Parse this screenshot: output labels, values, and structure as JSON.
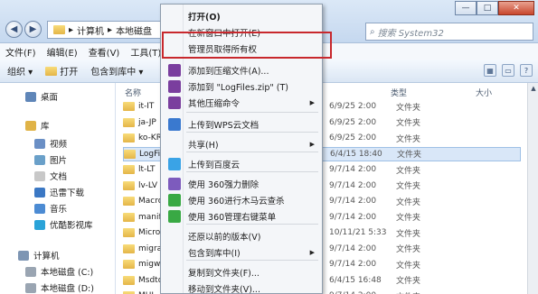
{
  "window": {
    "minimize": "—",
    "maximize": "□",
    "close": "✕"
  },
  "nav": {
    "back": "◀",
    "forward": "▶"
  },
  "address": {
    "crumbs": [
      "▸",
      "计算机",
      "▸",
      "本地磁盘"
    ]
  },
  "search": {
    "placeholder": "搜索 System32"
  },
  "menubar": [
    "文件(F)",
    "编辑(E)",
    "查看(V)",
    "工具(T)"
  ],
  "toolbar": {
    "organize": "组织 ▾",
    "open": "打开",
    "include": "包含到库中 ▾"
  },
  "sidebar": {
    "items": [
      {
        "label": "桌面",
        "icon": "desktop-icon",
        "color": "#5f86b8"
      },
      {
        "label": "库",
        "icon": "library-icon",
        "color": "#e0b347"
      },
      {
        "label": "视频",
        "icon": "video-icon",
        "color": "#6a8fc5"
      },
      {
        "label": "图片",
        "icon": "picture-icon",
        "color": "#6aa0c9"
      },
      {
        "label": "文档",
        "icon": "document-icon",
        "color": "#c8c8c8"
      },
      {
        "label": "迅雷下载",
        "icon": "thunder-icon",
        "color": "#3b78c4"
      },
      {
        "label": "音乐",
        "icon": "music-icon",
        "color": "#4c8bd3"
      },
      {
        "label": "优酷影视库",
        "icon": "youku-icon",
        "color": "#2aa3d8"
      },
      {
        "label": "计算机",
        "icon": "computer-icon",
        "color": "#7d95b3"
      },
      {
        "label": "本地磁盘 (C:)",
        "icon": "drive-icon",
        "color": "#9aa5b2"
      },
      {
        "label": "本地磁盘 (D:)",
        "icon": "drive-icon",
        "color": "#9aa5b2"
      }
    ]
  },
  "list": {
    "columns": {
      "name": "名称",
      "type": "类型",
      "size": "大小"
    },
    "rows": [
      {
        "name": "it-IT",
        "date": "6/9/25 2:00",
        "type": "文件夹"
      },
      {
        "name": "ja-JP",
        "date": "6/9/25 2:00",
        "type": "文件夹"
      },
      {
        "name": "ko-KR",
        "date": "6/9/25 2:00",
        "type": "文件夹"
      },
      {
        "name": "LogFil",
        "date": "6/4/15 18:40",
        "type": "文件夹"
      },
      {
        "name": "lt-LT",
        "date": "9/7/14 2:00",
        "type": "文件夹"
      },
      {
        "name": "lv-LV",
        "date": "9/7/14 2:00",
        "type": "文件夹"
      },
      {
        "name": "Macro",
        "date": "9/7/14 2:00",
        "type": "文件夹"
      },
      {
        "name": "manif",
        "date": "9/7/14 2:00",
        "type": "文件夹"
      },
      {
        "name": "Micro",
        "date": "10/11/21 5:33",
        "type": "文件夹"
      },
      {
        "name": "migra",
        "date": "9/7/14 2:00",
        "type": "文件夹"
      },
      {
        "name": "migwi",
        "date": "9/7/14 2:00",
        "type": "文件夹"
      },
      {
        "name": "Msdto",
        "date": "6/4/15 16:48",
        "type": "文件夹"
      },
      {
        "name": "MUI",
        "date": "9/7/14 2:00",
        "type": "文件夹"
      }
    ]
  },
  "context_menu": {
    "items": [
      {
        "label": "打开(O)",
        "bold": true,
        "icon": ""
      },
      {
        "label": "在新窗口中打开(E)",
        "icon": ""
      },
      {
        "label": "管理员取得所有权",
        "icon": ""
      },
      {
        "label": "添加到压缩文件(A)...",
        "icon": "winrar-icon",
        "color": "#7a3e9e"
      },
      {
        "label": "添加到 \"LogFiles.zip\" (T)",
        "icon": "winrar-icon",
        "color": "#7a3e9e"
      },
      {
        "label": "其他压缩命令",
        "icon": "winrar-icon",
        "color": "#7a3e9e",
        "submenu": true
      },
      {
        "label": "上传到WPS云文档",
        "icon": "wps-cloud-icon",
        "color": "#3a79cf"
      },
      {
        "label": "共享(H)",
        "icon": "",
        "submenu": true
      },
      {
        "label": "上传到百度云",
        "icon": "baidu-cloud-icon",
        "color": "#3aa3e6"
      },
      {
        "label": "使用 360强力删除",
        "icon": "360-icon",
        "color": "#7d5bbd"
      },
      {
        "label": "使用 360进行木马云查杀",
        "icon": "360-icon",
        "color": "#39a944"
      },
      {
        "label": "使用 360管理右键菜单",
        "icon": "360-icon",
        "color": "#39a944"
      },
      {
        "label": "还原以前的版本(V)",
        "icon": ""
      },
      {
        "label": "包含到库中(I)",
        "icon": "",
        "submenu": true
      },
      {
        "label": "复制到文件夹(F)...",
        "icon": ""
      },
      {
        "label": "移动到文件夹(V)...",
        "icon": ""
      }
    ]
  }
}
